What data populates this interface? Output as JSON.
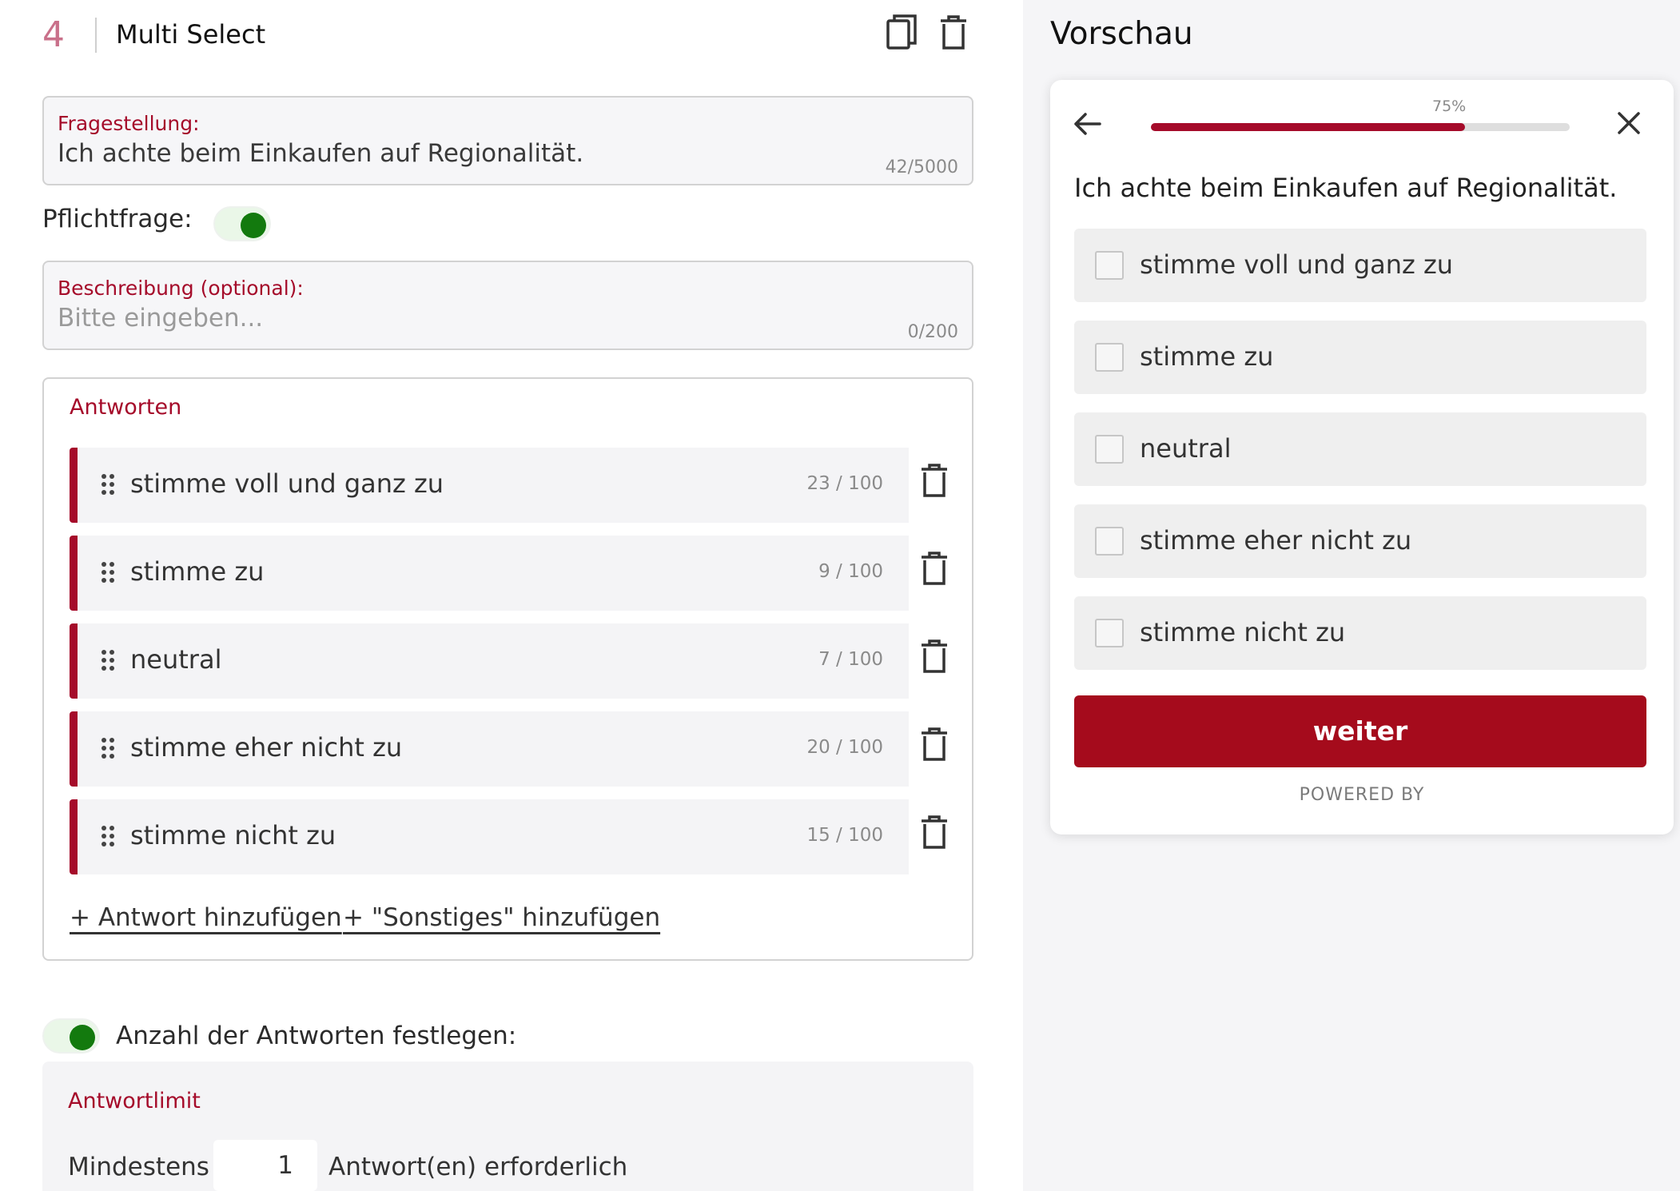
{
  "question": {
    "number": "4",
    "type": "Multi Select"
  },
  "header_icons": [
    "copy-icon",
    "trash-icon"
  ],
  "question_field": {
    "label": "Fragestellung:",
    "value": "Ich achte beim Einkaufen auf Regionalität.",
    "counter": "42/5000"
  },
  "required": {
    "label": "Pflichtfrage:",
    "enabled": true
  },
  "description_field": {
    "label": "Beschreibung (optional):",
    "placeholder": "Bitte eingeben...",
    "counter": "0/200"
  },
  "answers": {
    "title": "Antworten",
    "items": [
      {
        "text": "stimme voll und ganz zu",
        "count": "23 / 100"
      },
      {
        "text": "stimme zu",
        "count": "9 / 100"
      },
      {
        "text": "neutral",
        "count": "7 / 100"
      },
      {
        "text": "stimme eher nicht zu",
        "count": "20 / 100"
      },
      {
        "text": "stimme nicht zu",
        "count": "15 / 100"
      }
    ],
    "add_answer": "+ Antwort hinzufügen",
    "add_other": "+ \"Sonstiges\" hinzufügen"
  },
  "answer_count": {
    "label": "Anzahl der Antworten festlegen:",
    "enabled": true
  },
  "limit": {
    "title": "Antwortlimit",
    "prefix": "Mindestens",
    "value": "1",
    "suffix": "Antwort(en) erforderlich"
  },
  "preview": {
    "title": "Vorschau",
    "progress_label": "75%",
    "progress_fraction": 0.75,
    "question": "Ich achte beim Einkaufen auf Regionalität.",
    "options": [
      "stimme voll und ganz zu",
      "stimme zu",
      "neutral",
      "stimme eher nicht zu",
      "stimme nicht zu"
    ],
    "button": "weiter",
    "powered_by": "POWERED BY"
  },
  "colors": {
    "accent": "#a50b2a",
    "toggle_on": "#137a0e",
    "question_number": "#c9708a"
  }
}
